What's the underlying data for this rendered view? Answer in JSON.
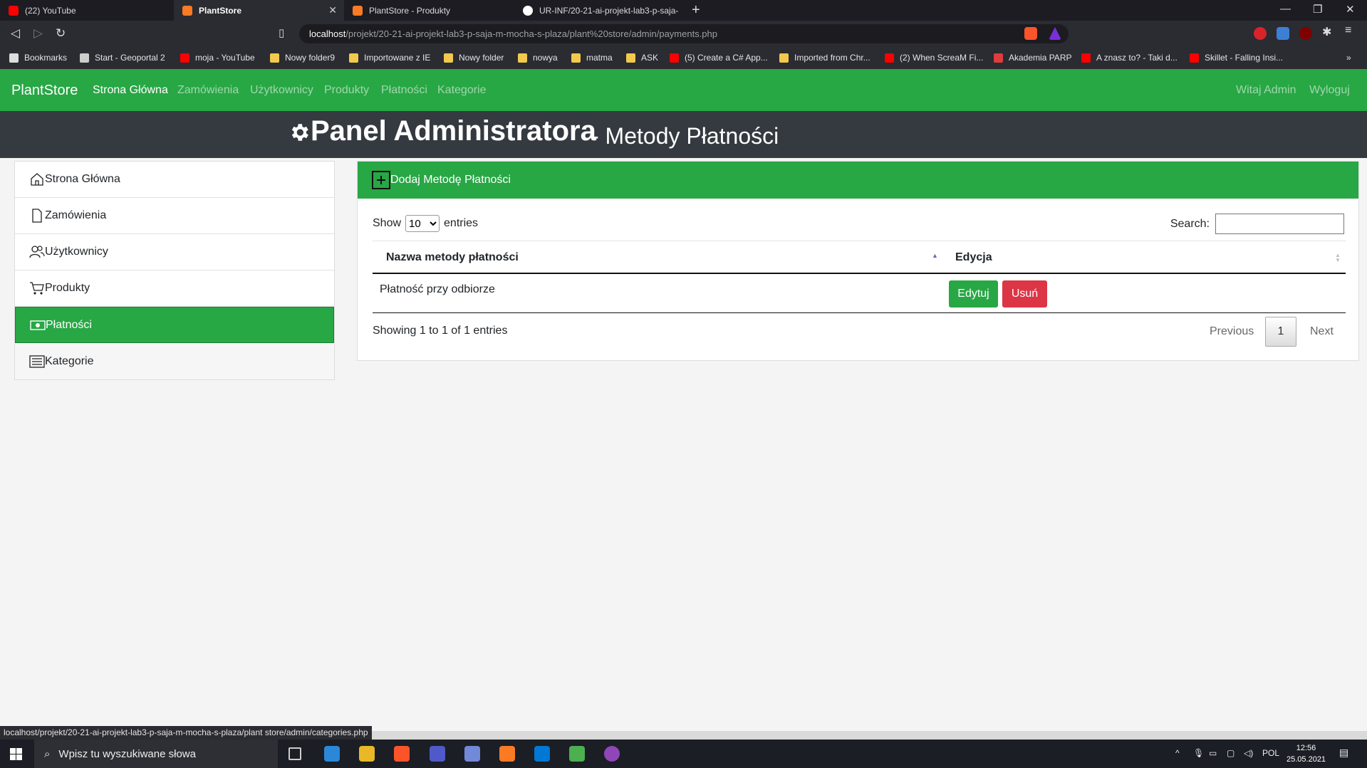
{
  "browser": {
    "tabs": [
      {
        "title": "(22) YouTube",
        "icon": "youtube-icon",
        "color": "#ff0000"
      },
      {
        "title": "PlantStore",
        "icon": "xampp-icon",
        "color": "#fb7a24",
        "active": true
      },
      {
        "title": "PlantStore - Produkty",
        "icon": "xampp-icon",
        "color": "#fb7a24"
      },
      {
        "title": "UR-INF/20-21-ai-projekt-lab3-p-saja-",
        "icon": "github-icon",
        "color": "#ffffff"
      }
    ],
    "url_host": "localhost",
    "url_path": "/projekt/20-21-ai-projekt-lab3-p-saja-m-mocha-s-plaza/plant%20store/admin/payments.php",
    "bookmarks": [
      {
        "label": "Bookmarks",
        "icon": "bookmarks-icon",
        "color": "#dddddd"
      },
      {
        "label": "Start - Geoportal 2",
        "icon": "page-icon",
        "color": "#cccccc"
      },
      {
        "label": "moja - YouTube",
        "icon": "youtube-icon",
        "color": "#ff0000"
      },
      {
        "label": "Nowy folder9",
        "icon": "folder-icon",
        "color": "#f2c94c"
      },
      {
        "label": "Importowane z IE",
        "icon": "folder-icon",
        "color": "#f2c94c"
      },
      {
        "label": "Nowy folder",
        "icon": "folder-icon",
        "color": "#f2c94c"
      },
      {
        "label": "nowya",
        "icon": "folder-icon",
        "color": "#f2c94c"
      },
      {
        "label": "matma",
        "icon": "folder-icon",
        "color": "#f2c94c"
      },
      {
        "label": "ASK",
        "icon": "folder-icon",
        "color": "#f2c94c"
      },
      {
        "label": "(5) Create a C# App...",
        "icon": "youtube-icon",
        "color": "#ff0000"
      },
      {
        "label": "Imported from Chr...",
        "icon": "folder-icon",
        "color": "#f2c94c"
      },
      {
        "label": "(2) When ScreaM Fi...",
        "icon": "youtube-icon",
        "color": "#ff0000"
      },
      {
        "label": "Akademia PARP",
        "icon": "parp-icon",
        "color": "#e03c3c"
      },
      {
        "label": "A znasz to? - Taki d...",
        "icon": "youtube-icon",
        "color": "#ff0000"
      },
      {
        "label": "Skillet - Falling Insi...",
        "icon": "youtube-icon",
        "color": "#ff0000"
      }
    ],
    "status_url": "localhost/projekt/20-21-ai-projekt-lab3-p-saja-m-mocha-s-plaza/plant store/admin/categories.php"
  },
  "nav": {
    "brand": "PlantStore",
    "links": [
      "Strona Główna",
      "Zamówienia",
      "Użytkownicy",
      "Produkty",
      "Płatności",
      "Kategorie"
    ],
    "greeting": "Witaj Admin",
    "logout": "Wyloguj"
  },
  "hero": {
    "title": "Panel Administratora",
    "subtitle": "- Metody Płatności"
  },
  "sidebar": {
    "items": [
      {
        "label": "Strona Główna",
        "icon": "home-icon"
      },
      {
        "label": "Zamówienia",
        "icon": "document-icon"
      },
      {
        "label": "Użytkownicy",
        "icon": "users-icon"
      },
      {
        "label": "Produkty",
        "icon": "cart-icon"
      },
      {
        "label": "Płatności",
        "icon": "cash-icon",
        "active": true
      },
      {
        "label": "Kategorie",
        "icon": "list-icon"
      }
    ]
  },
  "panel": {
    "add_label": "Dodaj Metodę Płatności",
    "show_label": "Show",
    "entries_label": "entries",
    "page_length": "10",
    "search_label": "Search:",
    "search_value": "",
    "columns": [
      "Nazwa metody płatności",
      "Edycja"
    ],
    "rows": [
      {
        "name": "Płatność przy odbiorze",
        "edit": "Edytuj",
        "delete": "Usuń"
      }
    ],
    "info": "Showing 1 to 1 of 1 entries",
    "prev": "Previous",
    "page": "1",
    "next": "Next"
  },
  "taskbar": {
    "search_placeholder": "Wpisz tu wyszukiwane słowa",
    "lang": "POL",
    "time": "12:56",
    "date": "25.05.2021"
  },
  "colors": {
    "accent": "#28a745",
    "danger": "#dc3545",
    "dark": "#343a40"
  }
}
